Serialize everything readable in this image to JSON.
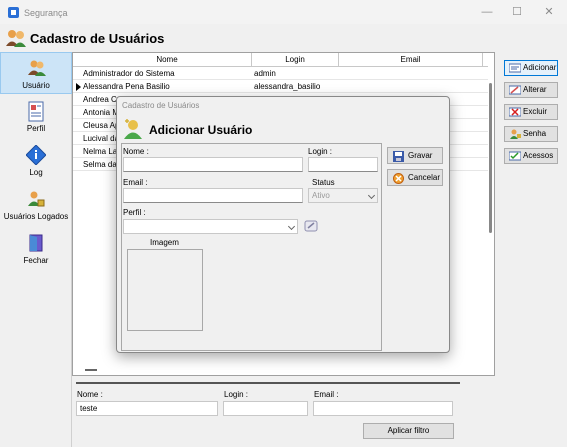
{
  "window": {
    "title": "Segurança",
    "minimize": "—",
    "maximize": "☐",
    "close": "✕"
  },
  "header": {
    "title": "Cadastro de Usuários"
  },
  "sidebar": {
    "items": [
      {
        "label": "Usuário",
        "icon": "users-icon"
      },
      {
        "label": "Perfil",
        "icon": "profile-document-icon"
      },
      {
        "label": "Log",
        "icon": "log-info-icon"
      },
      {
        "label": "Usuários Logados",
        "icon": "logged-users-icon"
      },
      {
        "label": "Fechar",
        "icon": "door-exit-icon"
      }
    ]
  },
  "grid": {
    "columns": [
      "Nome",
      "Login",
      "Email"
    ],
    "rows": [
      {
        "nome": "Administrador do Sistema",
        "login": "admin",
        "email": ""
      },
      {
        "nome": "Alessandra Pena Basilio",
        "login": "alessandra_basilio",
        "email": ""
      },
      {
        "nome": "Andrea Co",
        "login": "",
        "email": ""
      },
      {
        "nome": "Antonia M",
        "login": "",
        "email": ""
      },
      {
        "nome": "Cleusa Ap",
        "login": "",
        "email": ""
      },
      {
        "nome": "Lucival da",
        "login": "",
        "email": ""
      },
      {
        "nome": "Nelma Laz",
        "login": "",
        "email": ""
      },
      {
        "nome": "Selma da",
        "login": "",
        "email": ""
      }
    ]
  },
  "actions": {
    "adicionar": "Adicionar",
    "alterar": "Alterar",
    "excluir": "Excluir",
    "senha": "Senha",
    "acessos": "Acessos"
  },
  "filter": {
    "nome_label": "Nome :",
    "nome_value": "teste",
    "login_label": "Login :",
    "login_value": "",
    "email_label": "Email :",
    "email_value": "",
    "apply_label": "Aplicar filtro"
  },
  "dialog": {
    "title": "Cadastro de Usuários",
    "heading": "Adicionar Usuário",
    "nome_label": "Nome :",
    "login_label": "Login :",
    "email_label": "Email :",
    "status_label": "Status",
    "status_value": "Ativo",
    "perfil_label": "Perfil :",
    "perfil_value": "",
    "imagem_label": "Imagem",
    "gravar": "Gravar",
    "cancelar": "Cancelar"
  }
}
